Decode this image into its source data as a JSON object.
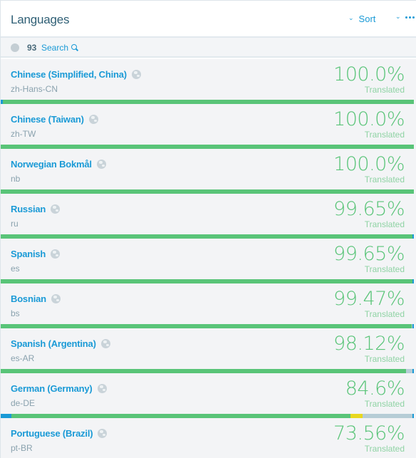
{
  "header": {
    "title": "Languages",
    "sort_label": "Sort",
    "sort_icon": "chevron-down-icon",
    "more_icon": "ellipsis-icon"
  },
  "toolbar": {
    "globe_icon": "globe-icon",
    "count": "93",
    "search_label": "Search",
    "search_icon": "search-icon"
  },
  "colors": {
    "translated": "#59c478",
    "approved": "#1a9ad6",
    "needs_review": "#e8d81f",
    "untranslated": "#b6cdd6",
    "link": "#1a9ad6"
  },
  "languages": [
    {
      "name": "Chinese (Simplified, China)",
      "code": "zh-Hans-CN",
      "percent": "100.0%",
      "status": "Translated",
      "approved": 0.005,
      "translated": 0.995,
      "review": 0,
      "untranslated": 0
    },
    {
      "name": "Chinese (Taiwan)",
      "code": "zh-TW",
      "percent": "100.0%",
      "status": "Translated",
      "approved": 0,
      "translated": 1.0,
      "review": 0,
      "untranslated": 0
    },
    {
      "name": "Norwegian Bokmål",
      "code": "nb",
      "percent": "100.0%",
      "status": "Translated",
      "approved": 0,
      "translated": 1.0,
      "review": 0,
      "untranslated": 0
    },
    {
      "name": "Russian",
      "code": "ru",
      "percent": "99.65%",
      "status": "Translated",
      "approved": 0,
      "translated": 0.9965,
      "review": 0,
      "untranslated": 0.0035
    },
    {
      "name": "Spanish",
      "code": "es",
      "percent": "99.65%",
      "status": "Translated",
      "approved": 0,
      "translated": 0.9965,
      "review": 0,
      "untranslated": 0.0035
    },
    {
      "name": "Bosnian",
      "code": "bs",
      "percent": "99.47%",
      "status": "Translated",
      "approved": 0,
      "translated": 0.9947,
      "review": 0,
      "untranslated": 0.0053
    },
    {
      "name": "Spanish (Argentina)",
      "code": "es-AR",
      "percent": "98.12%",
      "status": "Translated",
      "approved": 0,
      "translated": 0.9812,
      "review": 0,
      "untranslated": 0.0188
    },
    {
      "name": "German (Germany)",
      "code": "de-DE",
      "percent": "84.6%",
      "status": "Translated",
      "approved": 0.025,
      "translated": 0.821,
      "review": 0.03,
      "untranslated": 0.124
    },
    {
      "name": "Portuguese (Brazil)",
      "code": "pt-BR",
      "percent": "73.56%",
      "status": "Translated",
      "approved": null,
      "translated": null,
      "review": null,
      "untranslated": null
    }
  ]
}
